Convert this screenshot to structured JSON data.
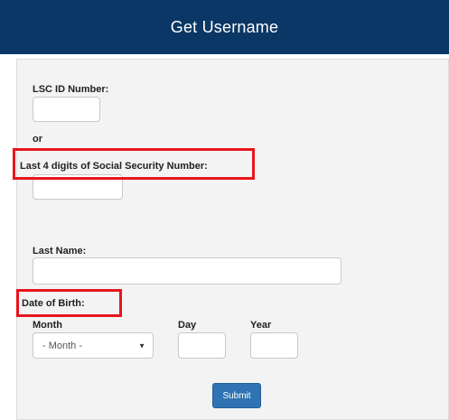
{
  "header": {
    "title": "Get Username"
  },
  "form": {
    "lsc_id_label": "LSC ID Number:",
    "or_text": "or",
    "ssn_label": "Last 4 digits of Social Security Number:",
    "last_name_label": "Last Name:",
    "dob_label": "Date of Birth:",
    "month_label": "Month",
    "day_label": "Day",
    "year_label": "Year",
    "month_selected": "- Month -",
    "submit_label": "Submit"
  },
  "annotations": {
    "highlight_color": "#e8151c"
  },
  "colors": {
    "header_bg": "#0b3766",
    "button_bg": "#2f73b3"
  }
}
